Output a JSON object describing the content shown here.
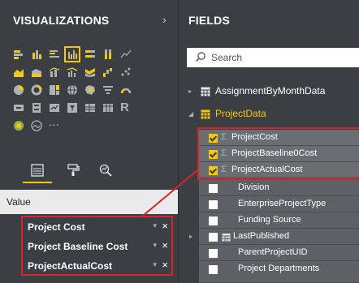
{
  "visualizations": {
    "title": "VISUALIZATIONS",
    "collapse_glyph": "›",
    "value_label": "Value",
    "ellipsis": "···",
    "r_visual": "R",
    "wells": [
      {
        "label": "Project Cost",
        "caret": "▾",
        "remove": "×"
      },
      {
        "label": "Project Baseline Cost",
        "caret": "▾",
        "remove": "×"
      },
      {
        "label": "ProjectActualCost",
        "caret": "▾",
        "remove": "×"
      }
    ]
  },
  "fields": {
    "title": "FIELDS",
    "search": {
      "placeholder": "Search"
    },
    "tables": [
      {
        "label": "AssignmentByMonthData",
        "expanded": false
      },
      {
        "label": "ProjectData",
        "expanded": true
      }
    ],
    "project_fields": [
      {
        "label": "ProjectCost",
        "checked": true,
        "sigma": true
      },
      {
        "label": "ProjectBaseline0Cost",
        "checked": true,
        "sigma": true
      },
      {
        "label": "ProjectActualCost",
        "checked": true,
        "sigma": true
      },
      {
        "label": "Division",
        "checked": false,
        "sigma": false
      },
      {
        "label": "EnterpriseProjectType",
        "checked": false,
        "sigma": false
      },
      {
        "label": "Funding Source",
        "checked": false,
        "sigma": false
      },
      {
        "label": "LastPublished",
        "checked": false,
        "sigma": false,
        "calendar": true
      },
      {
        "label": "ParentProjectUID",
        "checked": false,
        "sigma": false
      },
      {
        "label": "Project Departments",
        "checked": false,
        "sigma": false
      }
    ]
  },
  "colors": {
    "pane_bg": "#3b3f44",
    "accent_yellow": "#f2c811",
    "highlight_red": "#d9242e",
    "row_bg": "#5d6166"
  }
}
